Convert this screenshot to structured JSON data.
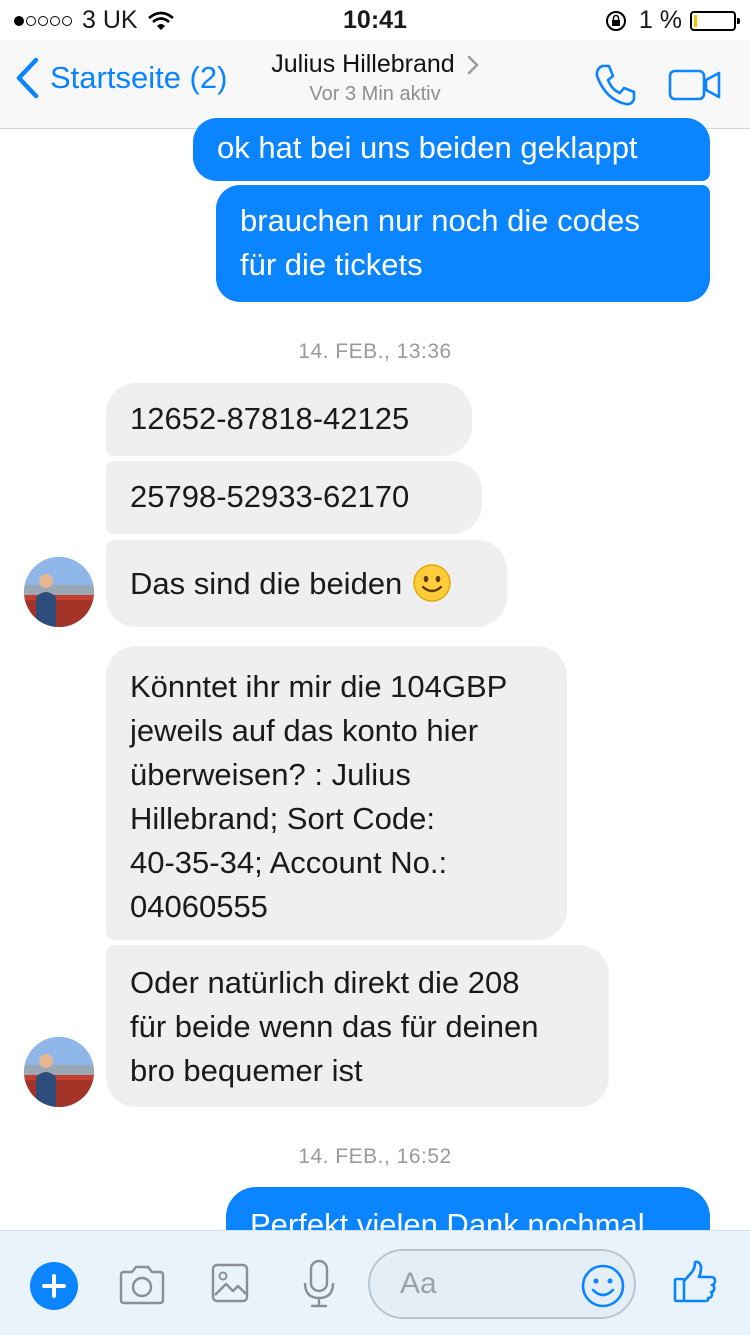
{
  "status_bar": {
    "carrier": "3 UK",
    "time": "10:41",
    "battery": "1 %"
  },
  "nav": {
    "back_label": "Startseite (2)",
    "contact_name": "Julius Hillebrand",
    "contact_status": "Vor 3 Min aktiv"
  },
  "messages": {
    "m1": "ok hat bei uns beiden geklappt",
    "m2_line1": "brauchen nur noch die codes",
    "m2_line2": "für die tickets",
    "ts1": "14. FEB., 13:36",
    "m3": "12652-87818-42125",
    "m4": "25798-52933-62170",
    "m5": "Das sind die beiden",
    "m6_lines": [
      "Könntet ihr mir die 104GBP",
      "jeweils auf das konto hier",
      "überweisen? : Julius",
      "Hillebrand; Sort Code:",
      "40-35-34; Account No.:",
      "04060555"
    ],
    "m7_lines": [
      "Oder natürlich direkt die 208",
      "für beide wenn das für deinen",
      "bro bequemer ist"
    ],
    "ts2": "14. FEB., 16:52",
    "m8": "Perfekt vielen Dank nochmal"
  },
  "composer": {
    "placeholder": "Aa"
  },
  "icons": {
    "back": "chevron-left-icon",
    "call": "phone-icon",
    "video": "video-camera-icon",
    "add": "plus-icon",
    "camera": "camera-icon",
    "gallery": "image-icon",
    "mic": "microphone-icon",
    "emoji": "smiley-icon",
    "like": "thumbs-up-icon"
  },
  "colors": {
    "accent": "#0a84ff",
    "incoming_bubble": "#efefef",
    "composer_bg": "#e9f3fb"
  }
}
